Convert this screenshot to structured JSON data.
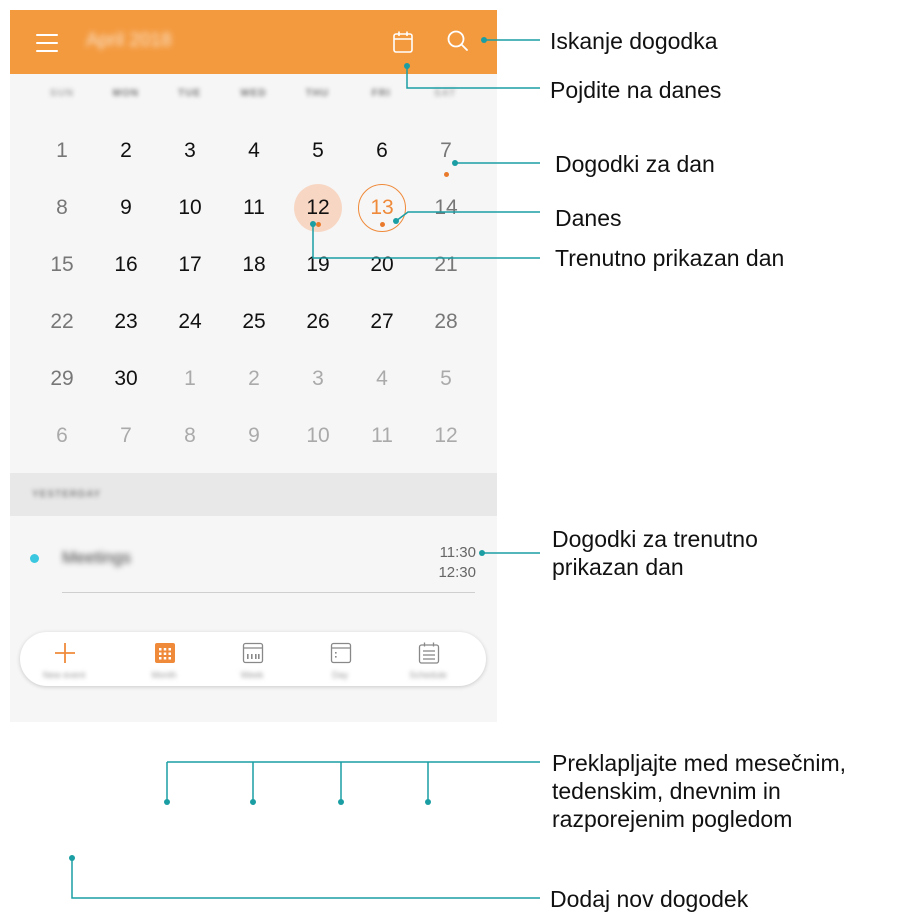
{
  "header": {
    "title": "April 2018",
    "accent_color": "#f39a3f",
    "icons": {
      "menu": "menu-icon",
      "go_to_today": "calendar-icon",
      "search": "search-icon"
    }
  },
  "weekdays": [
    "SUN",
    "MON",
    "TUE",
    "WED",
    "THU",
    "FRI",
    "SAT"
  ],
  "calendar": {
    "weeks": [
      [
        "1",
        "2",
        "3",
        "4",
        "5",
        "6",
        "7"
      ],
      [
        "8",
        "9",
        "10",
        "11",
        "12",
        "13",
        "14"
      ],
      [
        "15",
        "16",
        "17",
        "18",
        "19",
        "20",
        "21"
      ],
      [
        "22",
        "23",
        "24",
        "25",
        "26",
        "27",
        "28"
      ],
      [
        "29",
        "30",
        "1",
        "2",
        "3",
        "4",
        "5"
      ],
      [
        "6",
        "7",
        "8",
        "9",
        "10",
        "11",
        "12"
      ]
    ],
    "selected_day": "12",
    "today": "13",
    "selected_color": "#f7d7c4",
    "today_color": "#ef8a3a"
  },
  "event_section": {
    "header": "YESTERDAY",
    "events": [
      {
        "title": "Meetings",
        "start": "11:30",
        "end": "12:30",
        "color": "#3bc7e0"
      }
    ]
  },
  "bottom_nav": [
    {
      "label": "New event",
      "icon": "plus-icon"
    },
    {
      "label": "Month",
      "icon": "month-view-icon"
    },
    {
      "label": "Week",
      "icon": "week-view-icon"
    },
    {
      "label": "Day",
      "icon": "day-view-icon"
    },
    {
      "label": "Schedule",
      "icon": "schedule-view-icon"
    }
  ],
  "annotations": {
    "search": "Iskanje dogodka",
    "today_button": "Pojdite na danes",
    "events_for_day": "Dogodki za dan",
    "today": "Danes",
    "current_day": "Trenutno prikazan dan",
    "events_current_day_1": "Dogodki za trenutno",
    "events_current_day_2": "prikazan dan",
    "switch_views_1": "Preklapljajte med mesečnim,",
    "switch_views_2": "tedenskim, dnevnim in",
    "switch_views_3": "razporejenim pogledom",
    "add_event": "Dodaj nov dogodek",
    "line_color": "#1a9ea3"
  }
}
